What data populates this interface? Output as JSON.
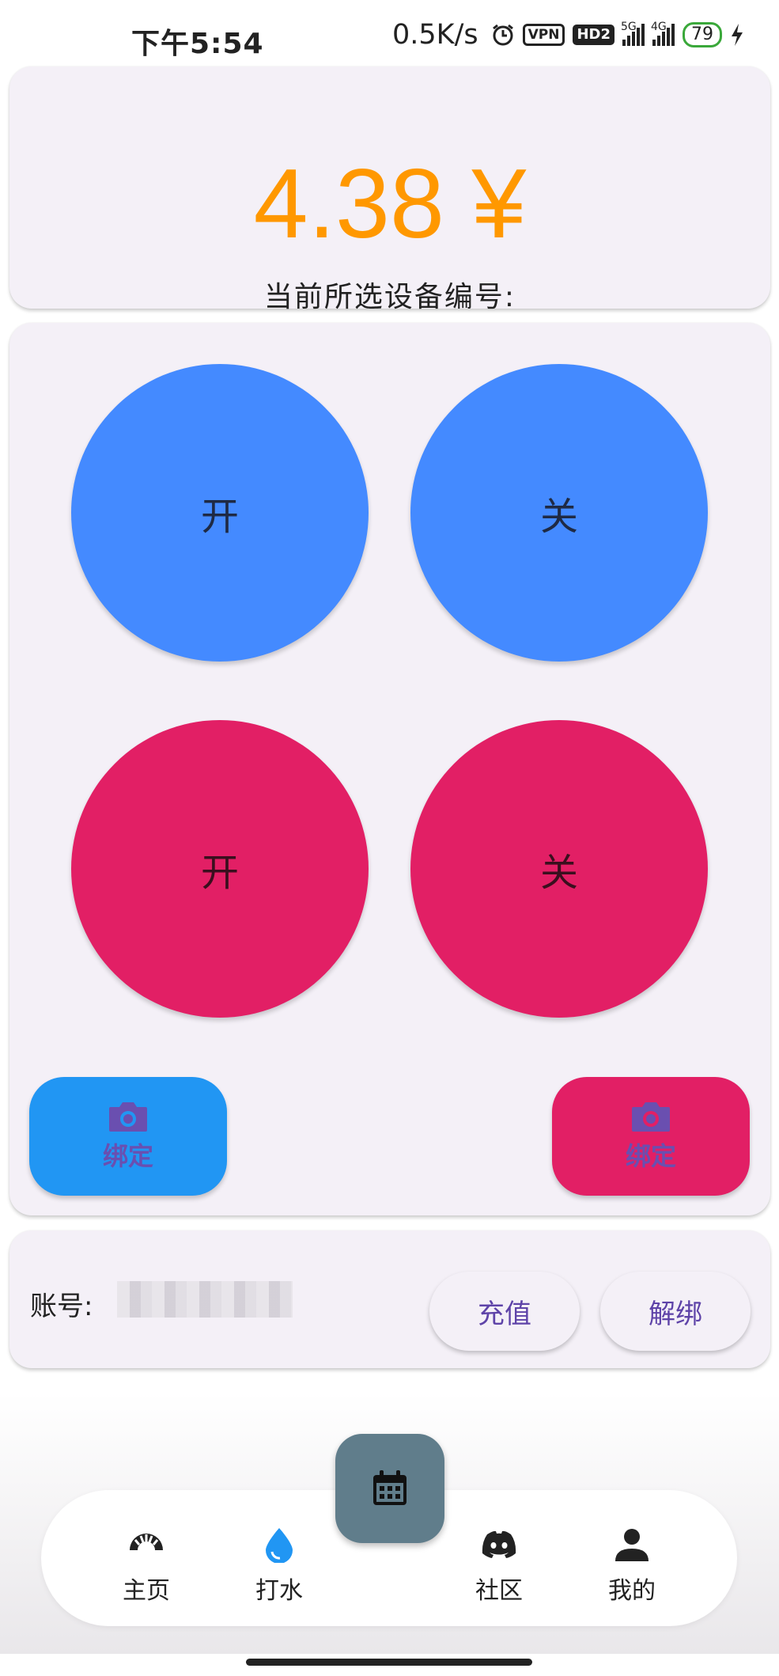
{
  "status_bar": {
    "time": "下午5:54",
    "net_speed": "0.5K/s",
    "vpn": "VPN",
    "hd": "HD2",
    "signal1_tag": "5G",
    "signal2_tag": "4G",
    "battery": "79"
  },
  "balance": {
    "amount": "4.38 ¥",
    "device_label": "当前所选设备编号:"
  },
  "controls": {
    "top_left": "开",
    "top_right": "关",
    "bottom_left": "开",
    "bottom_right": "关",
    "bind_left": "绑定",
    "bind_right": "绑定"
  },
  "account": {
    "label": "账号:",
    "recharge": "充值",
    "unbind": "解绑"
  },
  "nav": {
    "home": "主页",
    "water": "打水",
    "community": "社区",
    "mine": "我的"
  },
  "icons": {
    "fab": "calendar-icon",
    "home": "rainbow-fan-icon",
    "water": "water-drop-icon",
    "community": "discord-icon",
    "mine": "person-icon",
    "bind": "camera-icon"
  },
  "colors": {
    "accent_orange": "#ff9800",
    "blue": "#448aff",
    "pink": "#e21f65",
    "fab": "#607d8b",
    "purple_text": "#5e43a8"
  }
}
